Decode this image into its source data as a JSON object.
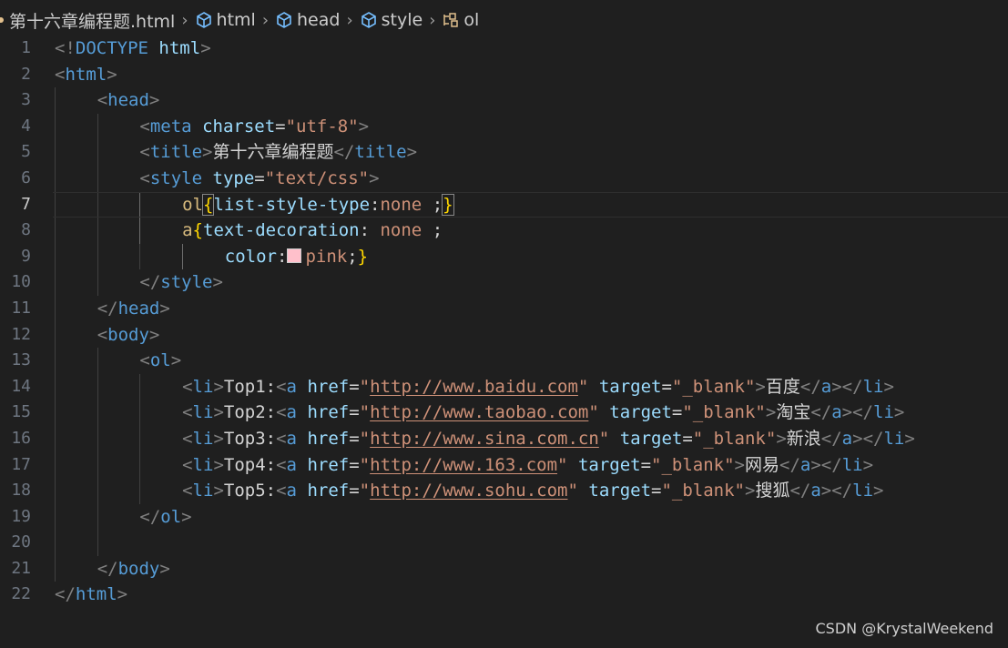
{
  "breadcrumb": {
    "file": "第十六章编程题.html",
    "items": [
      "html",
      "head",
      "style",
      "ol"
    ]
  },
  "editor": {
    "current_line": 7,
    "lines": [
      {
        "n": "1",
        "guides": 0,
        "tokens": [
          [
            "p",
            "<!"
          ],
          [
            "t",
            "DOCTYPE"
          ],
          [
            "tx",
            " "
          ],
          [
            "a",
            "html"
          ],
          [
            "p",
            ">"
          ]
        ]
      },
      {
        "n": "2",
        "guides": 0,
        "tokens": [
          [
            "p",
            "<"
          ],
          [
            "t",
            "html"
          ],
          [
            "p",
            ">"
          ]
        ]
      },
      {
        "n": "3",
        "guides": 1,
        "tokens": [
          [
            "p",
            "<"
          ],
          [
            "t",
            "head"
          ],
          [
            "p",
            ">"
          ]
        ]
      },
      {
        "n": "4",
        "guides": 2,
        "tokens": [
          [
            "p",
            "<"
          ],
          [
            "t",
            "meta"
          ],
          [
            "tx",
            " "
          ],
          [
            "a",
            "charset"
          ],
          [
            "tx",
            "="
          ],
          [
            "s",
            "\"utf-8\""
          ],
          [
            "p",
            ">"
          ]
        ]
      },
      {
        "n": "5",
        "guides": 2,
        "tokens": [
          [
            "p",
            "<"
          ],
          [
            "t",
            "title"
          ],
          [
            "p",
            ">"
          ],
          [
            "tx",
            "第十六章编程题"
          ],
          [
            "p",
            "</"
          ],
          [
            "t",
            "title"
          ],
          [
            "p",
            ">"
          ]
        ]
      },
      {
        "n": "6",
        "guides": 2,
        "tokens": [
          [
            "p",
            "<"
          ],
          [
            "t",
            "style"
          ],
          [
            "tx",
            " "
          ],
          [
            "a",
            "type"
          ],
          [
            "tx",
            "="
          ],
          [
            "s",
            "\"text/css\""
          ],
          [
            "p",
            ">"
          ]
        ]
      },
      {
        "n": "7",
        "guides": 3,
        "tokens": [
          [
            "k",
            "ol"
          ],
          [
            "yb",
            "{"
          ],
          [
            "a",
            "list-style-type"
          ],
          [
            "tx",
            ":"
          ],
          [
            "s",
            "none"
          ],
          [
            "tx",
            " ;"
          ],
          [
            "yb",
            "}"
          ]
        ]
      },
      {
        "n": "8",
        "guides": 3,
        "tokens": [
          [
            "k",
            "a"
          ],
          [
            "y",
            "{"
          ],
          [
            "a",
            "text-decoration"
          ],
          [
            "tx",
            ": "
          ],
          [
            "s",
            "none"
          ],
          [
            "tx",
            " ;"
          ]
        ]
      },
      {
        "n": "9",
        "guides": 4,
        "tokens": [
          [
            "a",
            "color"
          ],
          [
            "tx",
            ":"
          ],
          [
            "sw",
            ""
          ],
          [
            "s",
            "pink"
          ],
          [
            "tx",
            ";"
          ],
          [
            "y",
            "}"
          ]
        ]
      },
      {
        "n": "10",
        "guides": 2,
        "tokens": [
          [
            "p",
            "</"
          ],
          [
            "t",
            "style"
          ],
          [
            "p",
            ">"
          ]
        ]
      },
      {
        "n": "11",
        "guides": 1,
        "tokens": [
          [
            "p",
            "</"
          ],
          [
            "t",
            "head"
          ],
          [
            "p",
            ">"
          ]
        ]
      },
      {
        "n": "12",
        "guides": 1,
        "tokens": [
          [
            "p",
            "<"
          ],
          [
            "t",
            "body"
          ],
          [
            "p",
            ">"
          ]
        ]
      },
      {
        "n": "13",
        "guides": 2,
        "tokens": [
          [
            "p",
            "<"
          ],
          [
            "t",
            "ol"
          ],
          [
            "p",
            ">"
          ]
        ]
      },
      {
        "n": "14",
        "guides": 3,
        "tokens": [
          [
            "p",
            "<"
          ],
          [
            "t",
            "li"
          ],
          [
            "p",
            ">"
          ],
          [
            "tx",
            "Top1:"
          ],
          [
            "p",
            "<"
          ],
          [
            "t",
            "a"
          ],
          [
            "tx",
            " "
          ],
          [
            "a",
            "href"
          ],
          [
            "tx",
            "="
          ],
          [
            "s",
            "\""
          ],
          [
            "su",
            "http://www.baidu.com"
          ],
          [
            "s",
            "\""
          ],
          [
            "tx",
            " "
          ],
          [
            "a",
            "target"
          ],
          [
            "tx",
            "="
          ],
          [
            "s",
            "\"_blank\""
          ],
          [
            "p",
            ">"
          ],
          [
            "tx",
            "百度"
          ],
          [
            "p",
            "</"
          ],
          [
            "t",
            "a"
          ],
          [
            "p",
            "></"
          ],
          [
            "t",
            "li"
          ],
          [
            "p",
            ">"
          ]
        ]
      },
      {
        "n": "15",
        "guides": 3,
        "tokens": [
          [
            "p",
            "<"
          ],
          [
            "t",
            "li"
          ],
          [
            "p",
            ">"
          ],
          [
            "tx",
            "Top2:"
          ],
          [
            "p",
            "<"
          ],
          [
            "t",
            "a"
          ],
          [
            "tx",
            " "
          ],
          [
            "a",
            "href"
          ],
          [
            "tx",
            "="
          ],
          [
            "s",
            "\""
          ],
          [
            "su",
            "http://www.taobao.com"
          ],
          [
            "s",
            "\""
          ],
          [
            "tx",
            " "
          ],
          [
            "a",
            "target"
          ],
          [
            "tx",
            "="
          ],
          [
            "s",
            "\"_blank\""
          ],
          [
            "p",
            ">"
          ],
          [
            "tx",
            "淘宝"
          ],
          [
            "p",
            "</"
          ],
          [
            "t",
            "a"
          ],
          [
            "p",
            "></"
          ],
          [
            "t",
            "li"
          ],
          [
            "p",
            ">"
          ]
        ]
      },
      {
        "n": "16",
        "guides": 3,
        "tokens": [
          [
            "p",
            "<"
          ],
          [
            "t",
            "li"
          ],
          [
            "p",
            ">"
          ],
          [
            "tx",
            "Top3:"
          ],
          [
            "p",
            "<"
          ],
          [
            "t",
            "a"
          ],
          [
            "tx",
            " "
          ],
          [
            "a",
            "href"
          ],
          [
            "tx",
            "="
          ],
          [
            "s",
            "\""
          ],
          [
            "su",
            "http://www.sina.com.cn"
          ],
          [
            "s",
            "\""
          ],
          [
            "tx",
            " "
          ],
          [
            "a",
            "target"
          ],
          [
            "tx",
            "="
          ],
          [
            "s",
            "\"_blank\""
          ],
          [
            "p",
            ">"
          ],
          [
            "tx",
            "新浪"
          ],
          [
            "p",
            "</"
          ],
          [
            "t",
            "a"
          ],
          [
            "p",
            "></"
          ],
          [
            "t",
            "li"
          ],
          [
            "p",
            ">"
          ]
        ]
      },
      {
        "n": "17",
        "guides": 3,
        "tokens": [
          [
            "p",
            "<"
          ],
          [
            "t",
            "li"
          ],
          [
            "p",
            ">"
          ],
          [
            "tx",
            "Top4:"
          ],
          [
            "p",
            "<"
          ],
          [
            "t",
            "a"
          ],
          [
            "tx",
            " "
          ],
          [
            "a",
            "href"
          ],
          [
            "tx",
            "="
          ],
          [
            "s",
            "\""
          ],
          [
            "su",
            "http://www.163.com"
          ],
          [
            "s",
            "\""
          ],
          [
            "tx",
            " "
          ],
          [
            "a",
            "target"
          ],
          [
            "tx",
            "="
          ],
          [
            "s",
            "\"_blank\""
          ],
          [
            "p",
            ">"
          ],
          [
            "tx",
            "网易"
          ],
          [
            "p",
            "</"
          ],
          [
            "t",
            "a"
          ],
          [
            "p",
            "></"
          ],
          [
            "t",
            "li"
          ],
          [
            "p",
            ">"
          ]
        ]
      },
      {
        "n": "18",
        "guides": 3,
        "tokens": [
          [
            "p",
            "<"
          ],
          [
            "t",
            "li"
          ],
          [
            "p",
            ">"
          ],
          [
            "tx",
            "Top5:"
          ],
          [
            "p",
            "<"
          ],
          [
            "t",
            "a"
          ],
          [
            "tx",
            " "
          ],
          [
            "a",
            "href"
          ],
          [
            "tx",
            "="
          ],
          [
            "s",
            "\""
          ],
          [
            "su",
            "http://www.sohu.com"
          ],
          [
            "s",
            "\""
          ],
          [
            "tx",
            " "
          ],
          [
            "a",
            "target"
          ],
          [
            "tx",
            "="
          ],
          [
            "s",
            "\"_blank\""
          ],
          [
            "p",
            ">"
          ],
          [
            "tx",
            "搜狐"
          ],
          [
            "p",
            "</"
          ],
          [
            "t",
            "a"
          ],
          [
            "p",
            "></"
          ],
          [
            "t",
            "li"
          ],
          [
            "p",
            ">"
          ]
        ]
      },
      {
        "n": "19",
        "guides": 2,
        "tokens": [
          [
            "p",
            "</"
          ],
          [
            "t",
            "ol"
          ],
          [
            "p",
            ">"
          ]
        ]
      },
      {
        "n": "20",
        "guides": 2,
        "tokens": []
      },
      {
        "n": "21",
        "guides": 1,
        "tokens": [
          [
            "p",
            "</"
          ],
          [
            "t",
            "body"
          ],
          [
            "p",
            ">"
          ]
        ]
      },
      {
        "n": "22",
        "guides": 0,
        "tokens": [
          [
            "p",
            "</"
          ],
          [
            "t",
            "html"
          ],
          [
            "p",
            ">"
          ]
        ]
      }
    ]
  },
  "watermark": "CSDN @KrystalWeekend",
  "colors": {
    "background": "#1f1f1f",
    "tag": "#569cd6",
    "attribute": "#9cdcfe",
    "string": "#ce9178",
    "selector": "#d7ba7d",
    "bracket": "#ffd700",
    "swatch_pink": "#ffc0cb"
  }
}
